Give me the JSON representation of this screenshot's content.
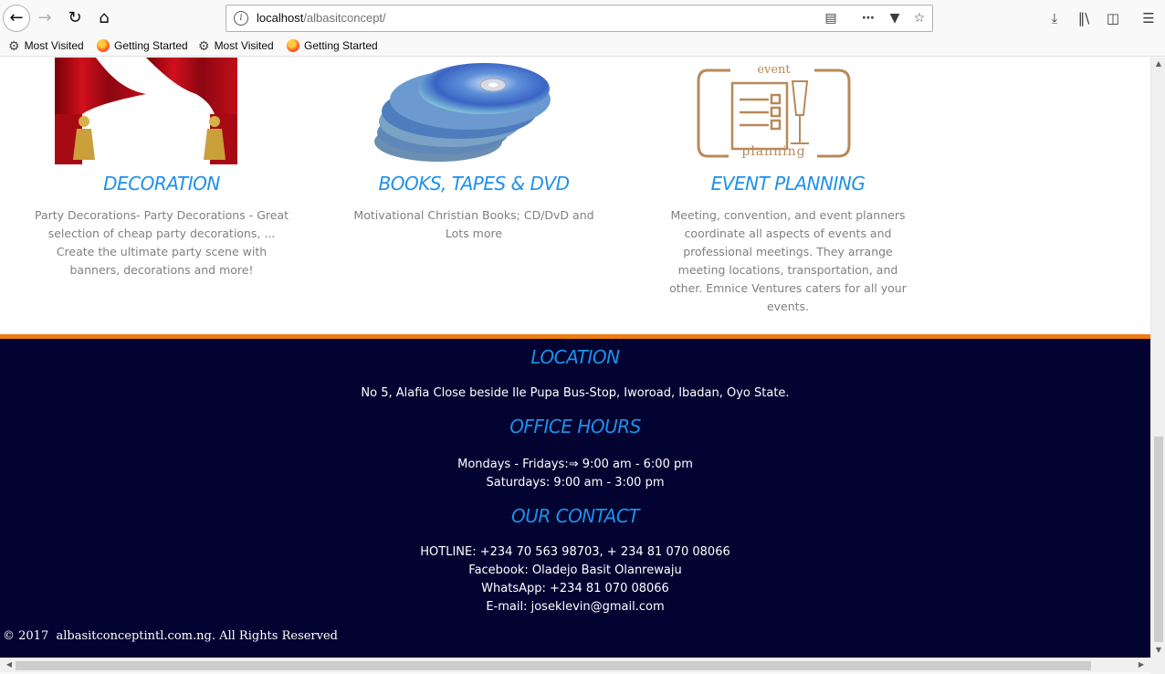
{
  "browser": {
    "url_host": "localhost",
    "url_path": "/albasitconcept/",
    "bookmarks": [
      {
        "label": "Most Visited",
        "icon": "gear-icon"
      },
      {
        "label": "Getting Started",
        "icon": "firefox-icon"
      },
      {
        "label": "Most Visited",
        "icon": "gear-icon"
      },
      {
        "label": "Getting Started",
        "icon": "firefox-icon"
      }
    ]
  },
  "services": [
    {
      "title": "DECORATION",
      "description": "Party Decorations- Party Decorations - Great selection of cheap party decorations, ... Create the ultimate party scene with banners, decorations and more!"
    },
    {
      "title": "BOOKS, TAPES & DVD",
      "description": "Motivational Christian Books; CD/DvD and Lots more"
    },
    {
      "title": "EVENT PLANNING",
      "description": "Meeting, convention, and event planners coordinate all aspects of events and professional meetings. They arrange meeting locations, transportation, and other. Emnice Ventures caters for all your events.",
      "logo_top_text": "event",
      "logo_bottom_text": "planning"
    }
  ],
  "footer": {
    "location_heading": "LOCATION",
    "address": "No 5, Alafia Close beside Ile Pupa Bus-Stop, Iworoad, Ibadan, Oyo State.",
    "hours_heading": "OFFICE HOURS",
    "hours_weekday": "Mondays - Fridays:⇒ 9:00 am - 6:00 pm",
    "hours_saturday": "Saturdays: 9:00 am - 3:00 pm",
    "contact_heading": "OUR CONTACT",
    "hotline": "HOTLINE: +234 70 563 98703, + 234 81 070 08066",
    "facebook": "Facebook: Oladejo Basit Olanrewaju",
    "whatsapp": "WhatsApp: +234 81 070 08066",
    "email": "E-mail: joseklevin@gmail.com",
    "copyright": "© 2017  albasitconceptintl.com.ng. All Rights Reserved"
  },
  "colors": {
    "accent_blue": "#1e90e8",
    "footer_bg": "#020331",
    "footer_border": "#f07d12"
  }
}
